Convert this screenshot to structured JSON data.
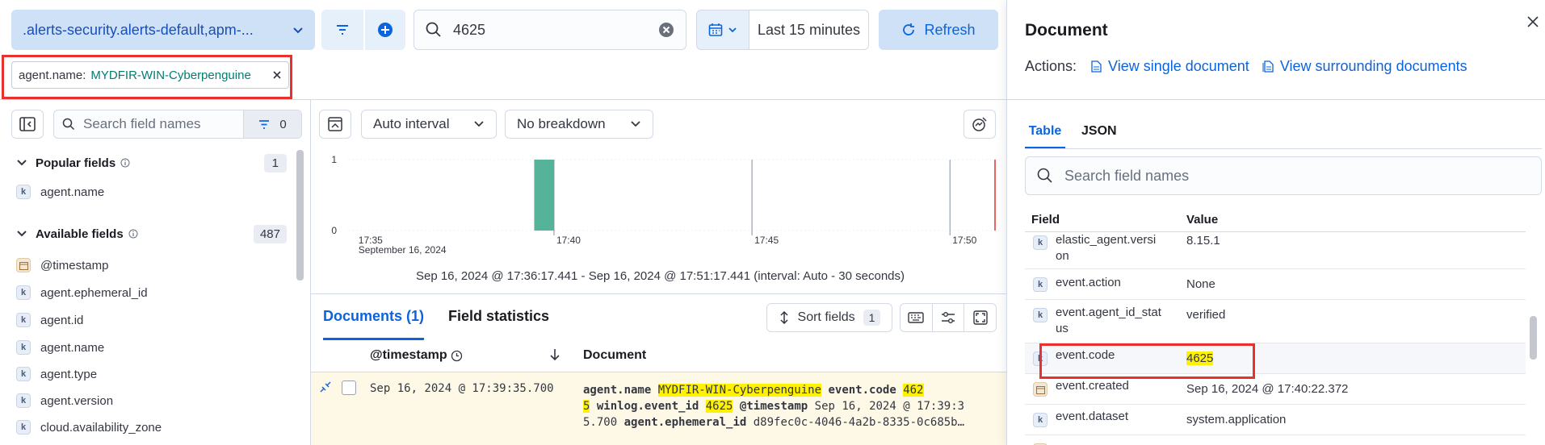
{
  "top": {
    "dataview_label": ".alerts-security.alerts-default,apm-...",
    "query_value": "4625",
    "time_range": "Last 15 minutes",
    "refresh_label": "Refresh"
  },
  "filter_pill": {
    "key": "agent.name:",
    "value": "MYDFIR-WIN-Cyberpenguine"
  },
  "sidebar": {
    "search_placeholder": "Search field names",
    "filter_count": "0",
    "popular": {
      "title": "Popular fields",
      "count": "1",
      "items": [
        "agent.name"
      ]
    },
    "available": {
      "title": "Available fields",
      "count": "487",
      "items": [
        {
          "name": "@timestamp",
          "type": "date"
        },
        {
          "name": "agent.ephemeral_id",
          "type": "k"
        },
        {
          "name": "agent.id",
          "type": "k"
        },
        {
          "name": "agent.name",
          "type": "k"
        },
        {
          "name": "agent.type",
          "type": "k"
        },
        {
          "name": "agent.version",
          "type": "k"
        },
        {
          "name": "cloud.availability_zone",
          "type": "k"
        }
      ]
    }
  },
  "chart_toolbar": {
    "interval": "Auto interval",
    "breakdown": "No breakdown"
  },
  "chart_data": {
    "type": "bar",
    "x_ticks": [
      "17:35",
      "17:40",
      "17:45",
      "17:50"
    ],
    "x_date": "September 16, 2024",
    "y_ticks": [
      "0",
      "1"
    ],
    "ylim": [
      0,
      1
    ],
    "bars": [
      {
        "x": "17:39:30",
        "value": 1
      }
    ],
    "range_text": "Sep 16, 2024 @ 17:36:17.441 - Sep 16, 2024 @ 17:51:17.441 (interval: Auto - 30 seconds)"
  },
  "docs": {
    "tab_documents": "Documents (1)",
    "tab_fieldstats": "Field statistics",
    "sort_label": "Sort fields",
    "sort_count": "1",
    "col_timestamp": "@timestamp",
    "col_document": "Document",
    "row": {
      "timestamp": "Sep 16, 2024 @ 17:39:35.700",
      "l1_k1": "agent.name",
      "l1_v1": "MYDFIR-WIN-Cyberpenguine",
      "l1_k2": "event.code",
      "l1_v2a": "462",
      "l2_v2b": "5",
      "l2_k3": "winlog.event_id",
      "l2_v3": "4625",
      "l2_k4": "@timestamp",
      "l2_v4": "Sep 16, 2024 @ 17:39:3",
      "l3_v4b": "5.700",
      "l3_k5": "agent.ephemeral_id",
      "l3_v5": "d89fec0c-4046-4a2b-8335-0c685b…"
    }
  },
  "flyout": {
    "title": "Document",
    "actions_label": "Actions:",
    "view_single": "View single document",
    "view_surrounding": "View surrounding documents",
    "tab_table": "Table",
    "tab_json": "JSON",
    "search_placeholder": "Search field names",
    "col_field": "Field",
    "col_value": "Value",
    "rows": [
      {
        "field": "elastic_agent.versi\non",
        "value": "8.15.1",
        "type": "k"
      },
      {
        "field": "event.action",
        "value": "None",
        "type": "k"
      },
      {
        "field": "event.agent_id_stat\nus",
        "value": "verified",
        "type": "k"
      },
      {
        "field": "event.code",
        "value": "4625",
        "type": "k"
      },
      {
        "field": "event.created",
        "value": "Sep 16, 2024 @ 17:40:22.372",
        "type": "date"
      },
      {
        "field": "event.dataset",
        "value": "system.application",
        "type": "k"
      }
    ]
  },
  "colors": {
    "accent": "#0b64dd",
    "bar": "#54b399",
    "annotation_red": "#e8312f",
    "highlight": "#fff200"
  }
}
